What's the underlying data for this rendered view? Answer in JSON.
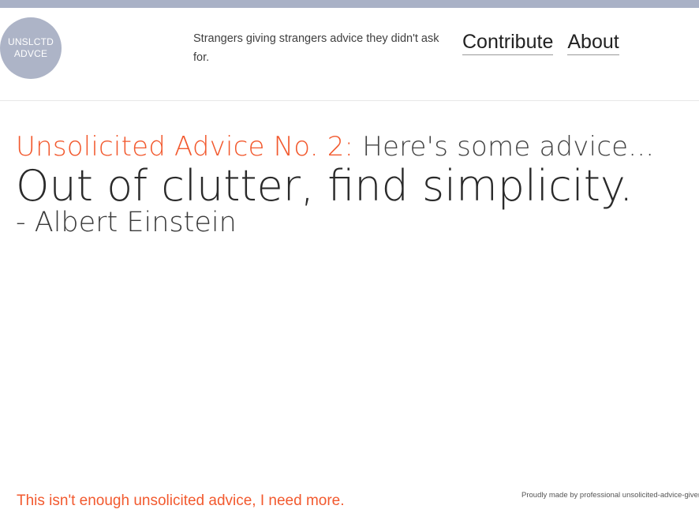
{
  "header": {
    "logo_lines": [
      "UNSLCTD",
      "ADVCE"
    ],
    "tagline": "Strangers giving strangers advice they didn't ask for.",
    "nav": [
      {
        "label": "Contribute"
      },
      {
        "label": "About"
      }
    ]
  },
  "advice": {
    "number_label": "Unsolicited Advice No. 2:",
    "intro": "Here's some advice...",
    "quote": "Out of clutter, find simplicity.",
    "author": "- Albert Einstein"
  },
  "footer": {
    "more_link": "This isn't enough unsolicited advice, I need more.",
    "credit": "Proudly made by professional unsolicited-advice-givers"
  },
  "colors": {
    "accent": "#f2592e",
    "logo_bg": "#adb4c7",
    "top_bar": "#a9b1c6"
  }
}
